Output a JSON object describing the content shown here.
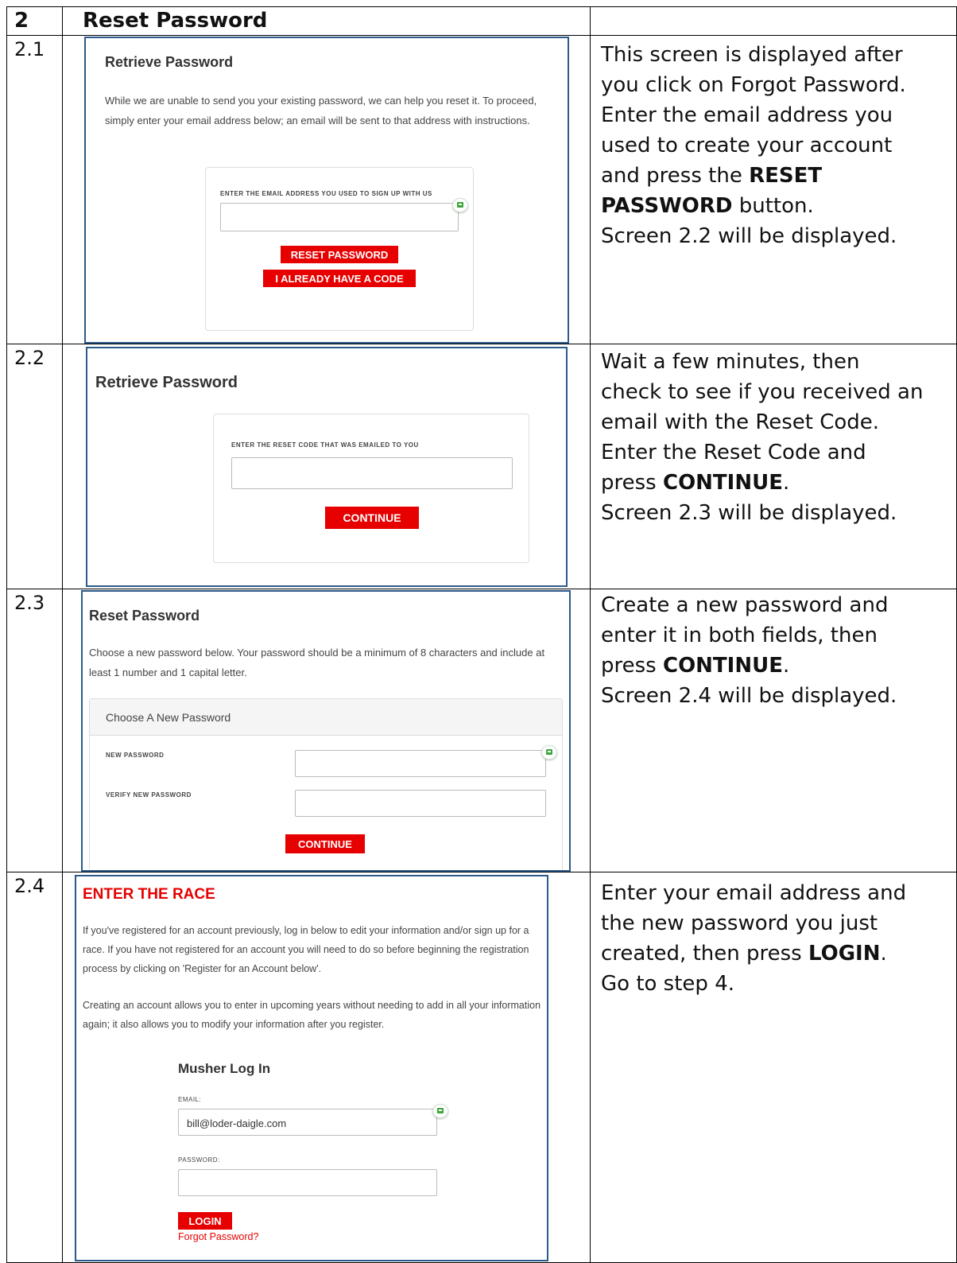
{
  "header": {
    "num": "2",
    "title": "Reset Password"
  },
  "rows": [
    {
      "num": "2.1",
      "desc": [
        "This screen is displayed after",
        "you click on Forgot Password.",
        "Enter the email address you",
        "used to create your account",
        {
          "pre": "and press the ",
          "bold": "RESET",
          "post": ""
        },
        {
          "pre": "",
          "bold": "PASSWORD",
          "post": " button."
        },
        "Screen 2.2 will be displayed."
      ]
    },
    {
      "num": "2.2",
      "desc": [
        "Wait a few minutes, then",
        "check to see if you received an",
        "email with the Reset Code.",
        "Enter the Reset Code and",
        {
          "pre": "press ",
          "bold": "CONTINUE",
          "post": "."
        },
        "Screen 2.3 will be displayed."
      ]
    },
    {
      "num": "2.3",
      "desc": [
        "Create a new password and",
        "enter it in both fields, then",
        {
          "pre": "press ",
          "bold": "CONTINUE",
          "post": "."
        },
        "Screen 2.4 will be displayed."
      ]
    },
    {
      "num": "2.4",
      "desc": [
        "Enter your email address and",
        "the new password you just",
        {
          "pre": "created, then press ",
          "bold": "LOGIN",
          "post": "."
        },
        "Go to step 4."
      ]
    }
  ],
  "screen_2_1": {
    "title": "Retrieve Password",
    "body": "While we are unable to send you your existing password, we can help you reset it. To proceed, simply enter your email address below; an email will be sent to that address with instructions.",
    "field_label": "ENTER THE EMAIL ADDRESS YOU USED TO SIGN UP WITH US",
    "email_value": "",
    "reset_button": "RESET PASSWORD",
    "code_button": "I ALREADY HAVE A CODE"
  },
  "screen_2_2": {
    "title": "Retrieve Password",
    "field_label": "ENTER THE RESET CODE THAT WAS EMAILED TO YOU",
    "code_value": "",
    "continue_button": "CONTINUE"
  },
  "screen_2_3": {
    "title": "Reset Password",
    "body": "Choose a new password below. Your password should be a minimum of 8 characters and include at least 1 number and 1 capital letter.",
    "panel_title": "Choose A New Password",
    "new_password_label": "NEW PASSWORD",
    "verify_password_label": "VERIFY NEW PASSWORD",
    "new_password_value": "",
    "verify_password_value": "",
    "continue_button": "CONTINUE"
  },
  "screen_2_4": {
    "title": "ENTER THE RACE",
    "body1": "If you've registered for an account previously, log in below to edit your information and/or sign up for a race. If you have not registered for an account you will need to do so before beginning the registration process by clicking on 'Register for an Account below'.",
    "body2": "Creating an account allows you to enter in upcoming years without needing to add in all your information again; it also allows you to modify your information after you register.",
    "login_title": "Musher Log In",
    "email_label": "EMAIL:",
    "email_value": "bill@loder-daigle.com",
    "password_label": "PASSWORD:",
    "password_value": "",
    "login_button": "LOGIN",
    "forgot_link": "Forgot Password?"
  },
  "colors": {
    "accent_red": "#e60000",
    "screenshot_border": "#2c5a8a",
    "password_manager_icon": "#3aa63a"
  }
}
